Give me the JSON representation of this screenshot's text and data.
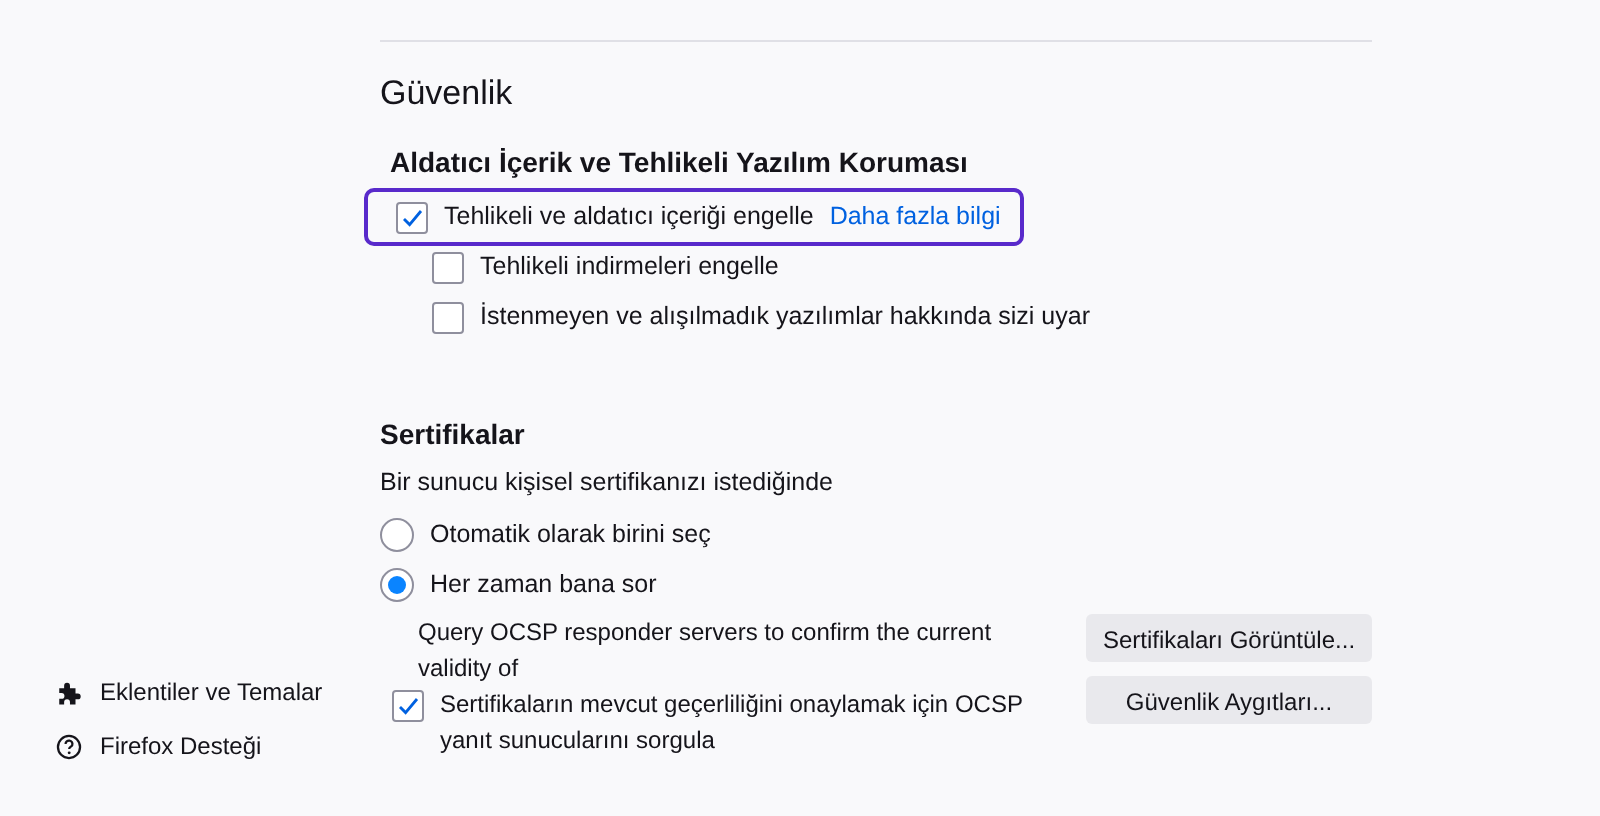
{
  "sidebar": {
    "items": [
      {
        "kind": "addons",
        "label": "Eklentiler ve Temalar"
      },
      {
        "kind": "help",
        "label": "Firefox Desteği"
      }
    ]
  },
  "section": {
    "title": "Güvenlik",
    "protection": {
      "heading": "Aldatıcı İçerik ve Tehlikeli Yazılım Koruması",
      "options": [
        {
          "label": "Tehlikeli ve aldatıcı içeriği engelle",
          "link": "Daha fazla bilgi",
          "checked": true,
          "focused": true,
          "nested": false
        },
        {
          "label": "Tehlikeli indirmeleri engelle",
          "checked": false,
          "focused": false,
          "nested": true
        },
        {
          "label": "İstenmeyen ve alışılmadık yazılımlar hakkında sizi uyar",
          "checked": false,
          "focused": false,
          "nested": true
        }
      ]
    },
    "certificates": {
      "heading": "Sertifikalar",
      "prompt": "Bir sunucu kişisel sertifikanızı istediğinde",
      "radios": [
        {
          "label": "Otomatik olarak birini seç",
          "selected": false
        },
        {
          "label": "Her zaman bana sor",
          "selected": true
        }
      ],
      "ocsp": {
        "note": "Query OCSP responder servers to confirm the current validity of",
        "label": "Sertifikaların mevcut geçerliliğini onaylamak için OCSP yanıt sunucularını sorgula",
        "checked": true
      },
      "buttons": [
        "Sertifikaları Görüntüle...",
        "Güvenlik Aygıtları..."
      ]
    }
  }
}
